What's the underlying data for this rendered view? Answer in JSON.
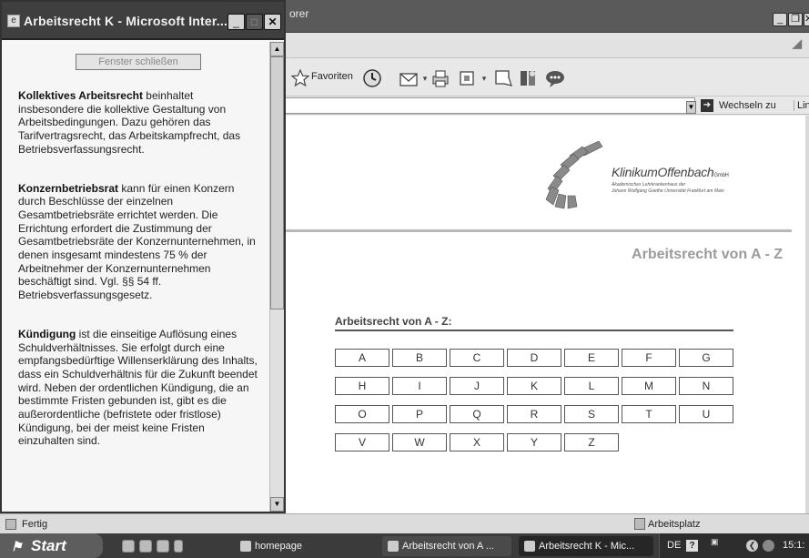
{
  "main_window": {
    "title_fragment": "orer",
    "toolbar": {
      "favorites_label": "Favoriten"
    },
    "address_bar": {
      "go_label": "Wechseln zu",
      "links_label": "Lin"
    },
    "content": {
      "logo": {
        "name_1": "Klinikum",
        "name_2": "Offenbach",
        "suffix": "GmbH",
        "subtitle_1": "Akademisches Lehrkrankenhaus der",
        "subtitle_2": "Johann Wolfgang Goethe Universität Frankfurt am Main"
      },
      "heading": "Arbeitsrecht von A - Z",
      "az_label": "Arbeitsrecht von A - Z:",
      "letters": [
        "A",
        "B",
        "C",
        "D",
        "E",
        "F",
        "G",
        "H",
        "I",
        "J",
        "K",
        "L",
        "M",
        "N",
        "O",
        "P",
        "Q",
        "R",
        "S",
        "T",
        "U",
        "V",
        "W",
        "X",
        "Y",
        "Z"
      ]
    },
    "status_bar": {
      "status": "Fertig",
      "zone": "Arbeitsplatz"
    }
  },
  "popup": {
    "title": "Arbeitsrecht K - Microsoft Inter...",
    "close_button": "Fenster schließen",
    "entries": [
      {
        "term": "Kollektives Arbeitsrecht",
        "text": " beinhaltet insbesondere die kollektive Gestaltung von Arbeitsbedingungen. Dazu gehören das Tarifvertragsrecht, das Arbeitskampfrecht, das Betriebsverfassungsrecht."
      },
      {
        "term": "Konzernbetriebsrat",
        "text": " kann für einen Konzern durch Beschlüsse der einzelnen Gesamtbetriebsräte errichtet werden. Die Errichtung erfordert die Zustimmung der Gesamtbetriebsräte der Konzernunternehmen, in denen insgesamt mindestens 75 % der Arbeitnehmer der Konzernunternehmen beschäftigt sind. Vgl. §§ 54 ff. Betriebsverfassungsgesetz."
      },
      {
        "term": "Kündigung",
        "text": " ist die einseitige Auflösung eines Schuldverhältnisses. Sie erfolgt durch eine empfangsbedürftige Willenserklärung des Inhalts, dass ein Schuldverhältnis für die Zukunft beendet wird. Neben der ordentlichen Kündigung, die an bestimmte Fristen gebunden ist, gibt es die außerordentliche (befristete oder fristlose) Kündigung, bei der meist keine Fristen einzuhalten sind."
      }
    ]
  },
  "taskbar": {
    "start_label": "Start",
    "tasks": [
      {
        "label": "homepage"
      },
      {
        "label": "Arbeitsrecht von A ..."
      },
      {
        "label": "Arbeitsrecht K - Mic..."
      }
    ],
    "tray": {
      "lang": "DE",
      "time": "15:1:"
    }
  }
}
